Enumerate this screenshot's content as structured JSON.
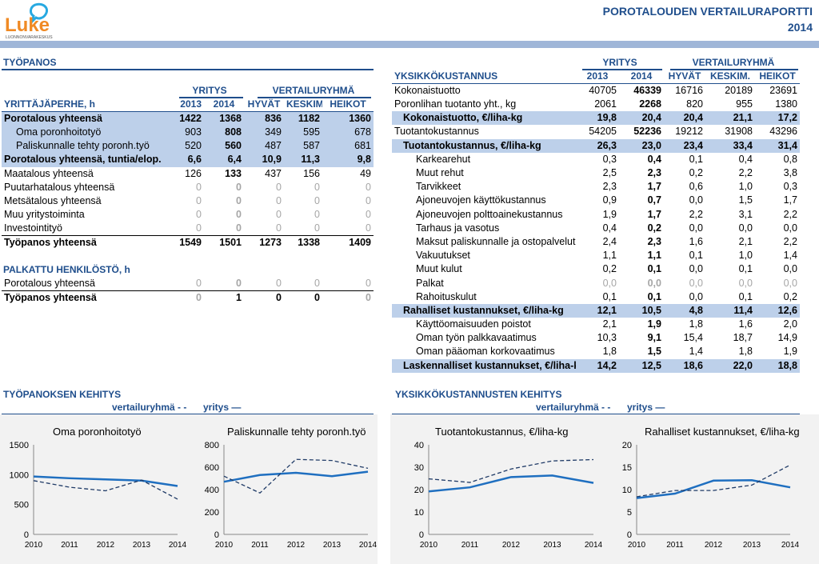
{
  "header": {
    "logo_text": "Luke",
    "logo_sub": "LUONNONVARAKESKUS",
    "title_line1": "POROTALOUDEN VERTAILURAPORTTI",
    "title_line2": "2014"
  },
  "tyopanos": {
    "section_title": "TYÖPANOS",
    "group_yritys": "YRITYS",
    "group_vertailu": "VERTAILURYHMÄ",
    "col_label": "YRITTÄJÄPERHE, h",
    "columns": [
      "2013",
      "2014",
      "HYVÄT",
      "KESKIM.",
      "HEIKOT"
    ],
    "rows": [
      {
        "label": "Porotalous yhteensä",
        "values": [
          "1422",
          "1368",
          "836",
          "1182",
          "1360"
        ],
        "style": "band"
      },
      {
        "label": "Oma poronhoitotyö",
        "values": [
          "903",
          "808",
          "349",
          "595",
          "678"
        ],
        "style": "band-sub"
      },
      {
        "label": "Paliskunnalle tehty poronh.työ",
        "values": [
          "520",
          "560",
          "487",
          "587",
          "681"
        ],
        "style": "band-sub"
      },
      {
        "label": "Porotalous yhteensä, tuntia/elop.",
        "values": [
          "6,6",
          "6,4",
          "10,9",
          "11,3",
          "9,8"
        ],
        "style": "band"
      },
      {
        "label": "Maatalous yhteensä",
        "values": [
          "126",
          "133",
          "437",
          "156",
          "49"
        ],
        "style": "normal"
      },
      {
        "label": "Puutarhatalous yhteensä",
        "values": [
          "0",
          "0",
          "0",
          "0",
          "0"
        ],
        "style": "grey"
      },
      {
        "label": "Metsätalous yhteensä",
        "values": [
          "0",
          "0",
          "0",
          "0",
          "0"
        ],
        "style": "grey"
      },
      {
        "label": "Muu yritystoiminta",
        "values": [
          "0",
          "0",
          "0",
          "0",
          "0"
        ],
        "style": "grey"
      },
      {
        "label": "Investointityö",
        "values": [
          "0",
          "0",
          "0",
          "0",
          "0"
        ],
        "style": "grey-line"
      },
      {
        "label": "Työpanos yhteensä",
        "values": [
          "1549",
          "1501",
          "1273",
          "1338",
          "1409"
        ],
        "style": "bold"
      }
    ],
    "palkattu_title": "PALKATTU HENKILÖSTÖ, h",
    "palkattu_rows": [
      {
        "label": "Porotalous yhteensä",
        "values": [
          "0",
          "0",
          "0",
          "0",
          "0"
        ],
        "style": "grey-line"
      },
      {
        "label": "Työpanos yhteensä",
        "values": [
          "0",
          "1",
          "0",
          "0",
          "0"
        ],
        "style": "bold-mixed"
      }
    ]
  },
  "yksikko": {
    "section_title": "YKSIKKÖKUSTANNUS",
    "group_yritys": "YRITYS",
    "group_vertailu": "VERTAILURYHMÄ",
    "columns": [
      "2013",
      "2014",
      "HYVÄT",
      "KESKIM.",
      "HEIKOT"
    ],
    "rows": [
      {
        "label": "Kokonaistuotto",
        "values": [
          "40705",
          "46339",
          "16716",
          "20189",
          "23691"
        ],
        "style": "normal"
      },
      {
        "label": "Poronlihan tuotanto yht., kg",
        "values": [
          "2061",
          "2268",
          "820",
          "955",
          "1380"
        ],
        "style": "normal"
      },
      {
        "label": "Kokonaistuotto, €/liha-kg",
        "values": [
          "19,8",
          "20,4",
          "20,4",
          "21,1",
          "17,2"
        ],
        "style": "band"
      },
      {
        "label": "Tuotantokustannus",
        "values": [
          "54205",
          "52236",
          "19212",
          "31908",
          "43296"
        ],
        "style": "normal"
      },
      {
        "label": "Tuotantokustannus, €/liha-kg",
        "values": [
          "26,3",
          "23,0",
          "23,4",
          "33,4",
          "31,4"
        ],
        "style": "band"
      },
      {
        "label": "Karkearehut",
        "values": [
          "0,3",
          "0,4",
          "0,1",
          "0,4",
          "0,8"
        ],
        "style": "sub"
      },
      {
        "label": "Muut rehut",
        "values": [
          "2,5",
          "2,3",
          "0,2",
          "2,2",
          "3,8"
        ],
        "style": "sub"
      },
      {
        "label": "Tarvikkeet",
        "values": [
          "2,3",
          "1,7",
          "0,6",
          "1,0",
          "0,3"
        ],
        "style": "sub"
      },
      {
        "label": "Ajoneuvojen käyttökustannus",
        "values": [
          "0,9",
          "0,7",
          "0,0",
          "1,5",
          "1,7"
        ],
        "style": "sub"
      },
      {
        "label": "Ajoneuvojen polttoainekustannus",
        "values": [
          "1,9",
          "1,7",
          "2,2",
          "3,1",
          "2,2"
        ],
        "style": "sub"
      },
      {
        "label": "Tarhaus ja vasotus",
        "values": [
          "0,4",
          "0,2",
          "0,0",
          "0,0",
          "0,0"
        ],
        "style": "sub"
      },
      {
        "label": "Maksut paliskunnalle ja ostopalvelut",
        "values": [
          "2,4",
          "2,3",
          "1,6",
          "2,1",
          "2,2"
        ],
        "style": "sub"
      },
      {
        "label": "Vakuutukset",
        "values": [
          "1,1",
          "1,1",
          "0,1",
          "1,0",
          "1,4"
        ],
        "style": "sub"
      },
      {
        "label": "Muut kulut",
        "values": [
          "0,2",
          "0,1",
          "0,0",
          "0,1",
          "0,0"
        ],
        "style": "sub"
      },
      {
        "label": "Palkat",
        "values": [
          "0,0",
          "0,0",
          "0,0",
          "0,0",
          "0,0"
        ],
        "style": "sub-grey"
      },
      {
        "label": "Rahoituskulut",
        "values": [
          "0,1",
          "0,1",
          "0,0",
          "0,1",
          "0,2"
        ],
        "style": "sub"
      },
      {
        "label": "Rahalliset kustannukset, €/liha-kg",
        "values": [
          "12,1",
          "10,5",
          "4,8",
          "11,4",
          "12,6"
        ],
        "style": "band"
      },
      {
        "label": "Käyttöomaisuuden poistot",
        "values": [
          "2,1",
          "1,9",
          "1,8",
          "1,6",
          "2,0"
        ],
        "style": "sub"
      },
      {
        "label": "Oman työn palkkavaatimus",
        "values": [
          "10,3",
          "9,1",
          "15,4",
          "18,7",
          "14,9"
        ],
        "style": "sub"
      },
      {
        "label": "Oman pääoman korkovaatimus",
        "values": [
          "1,8",
          "1,5",
          "1,4",
          "1,8",
          "1,9"
        ],
        "style": "sub"
      },
      {
        "label": "Laskennalliset kustannukset, €/liha-kg",
        "values": [
          "14,2",
          "12,5",
          "18,6",
          "22,0",
          "18,8"
        ],
        "style": "band"
      }
    ]
  },
  "kehitys_left": {
    "section_title": "TYÖPANOKSEN KEHITYS",
    "legend_vertailu": "vertailuryhmä - -",
    "legend_yritys": "yritys —"
  },
  "kehitys_right": {
    "section_title": "YKSIKKÖKUSTANNUSTEN KEHITYS",
    "legend_vertailu": "vertailuryhmä - -",
    "legend_yritys": "yritys —"
  },
  "colors": {
    "accent": "#1f4e8c",
    "band": "#bdd0ea",
    "line": "#1f6fc0",
    "panel": "#f2f2f2"
  },
  "chart_data": [
    {
      "type": "line",
      "title": "Oma poronhoitotyö",
      "x": [
        "2010",
        "2011",
        "2012",
        "2013",
        "2014"
      ],
      "yticks": [
        "0",
        "500",
        "1000",
        "1500"
      ],
      "ylim": [
        0,
        1500
      ],
      "series": [
        {
          "name": "yritys",
          "style": "solid",
          "values": [
            970,
            940,
            920,
            900,
            810
          ]
        },
        {
          "name": "vertailuryhmä",
          "style": "dashed",
          "values": [
            900,
            790,
            730,
            910,
            590
          ]
        }
      ]
    },
    {
      "type": "line",
      "title": "Paliskunnalle tehty poronh.työ",
      "x": [
        "2010",
        "2011",
        "2012",
        "2013",
        "2014"
      ],
      "yticks": [
        "0",
        "200",
        "400",
        "600",
        "800"
      ],
      "ylim": [
        0,
        800
      ],
      "series": [
        {
          "name": "yritys",
          "style": "solid",
          "values": [
            470,
            530,
            550,
            520,
            560
          ]
        },
        {
          "name": "vertailuryhmä",
          "style": "dashed",
          "values": [
            520,
            370,
            670,
            660,
            590
          ]
        }
      ]
    },
    {
      "type": "line",
      "title": "Tuotantokustannus, €/liha-kg",
      "x": [
        "2010",
        "2011",
        "2012",
        "2013",
        "2014"
      ],
      "yticks": [
        "0",
        "10",
        "20",
        "30",
        "40"
      ],
      "ylim": [
        0,
        40
      ],
      "series": [
        {
          "name": "yritys",
          "style": "solid",
          "values": [
            19.2,
            21,
            25.6,
            26.3,
            23
          ]
        },
        {
          "name": "vertailuryhmä",
          "style": "dashed",
          "values": [
            24.8,
            23.2,
            29.2,
            32.8,
            33.4
          ]
        }
      ]
    },
    {
      "type": "line",
      "title": "Rahalliset kustannukset, €/liha-kg",
      "x": [
        "2010",
        "2011",
        "2012",
        "2013",
        "2014"
      ],
      "yticks": [
        "0",
        "5",
        "10",
        "15",
        "20"
      ],
      "ylim": [
        0,
        20
      ],
      "series": [
        {
          "name": "yritys",
          "style": "solid",
          "values": [
            8.1,
            9.1,
            12,
            12.1,
            10.5
          ]
        },
        {
          "name": "vertailuryhmä",
          "style": "dashed",
          "values": [
            8.4,
            9.8,
            9.8,
            11,
            15.5
          ]
        }
      ]
    }
  ]
}
